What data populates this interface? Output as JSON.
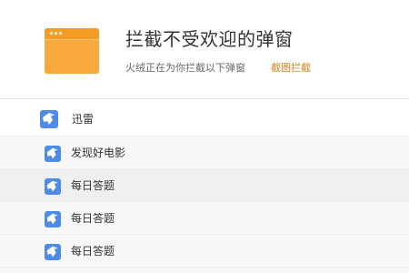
{
  "header": {
    "title": "拦截不受欢迎的弹窗",
    "subtitle": "火绒正在为你拦截以下弹窗",
    "screenshot_block_link": "截图拦截",
    "icon": "window-icon",
    "colors": {
      "icon_main": "#f7a93b",
      "icon_bar": "#f49c24",
      "link": "#d0841b"
    }
  },
  "popup_list": {
    "parent": {
      "label": "迅雷",
      "icon": "xunlei-bird-icon"
    },
    "items": [
      {
        "label": "发现好电影",
        "icon": "xunlei-bird-icon"
      },
      {
        "label": "每日答题",
        "icon": "xunlei-bird-icon"
      },
      {
        "label": "每日答题",
        "icon": "xunlei-bird-icon"
      },
      {
        "label": "每日答题",
        "icon": "xunlei-bird-icon"
      }
    ],
    "colors": {
      "app_icon": "#4d8be6",
      "row_bg": "#f7f7f7",
      "selected_bg": "#efefef"
    }
  }
}
